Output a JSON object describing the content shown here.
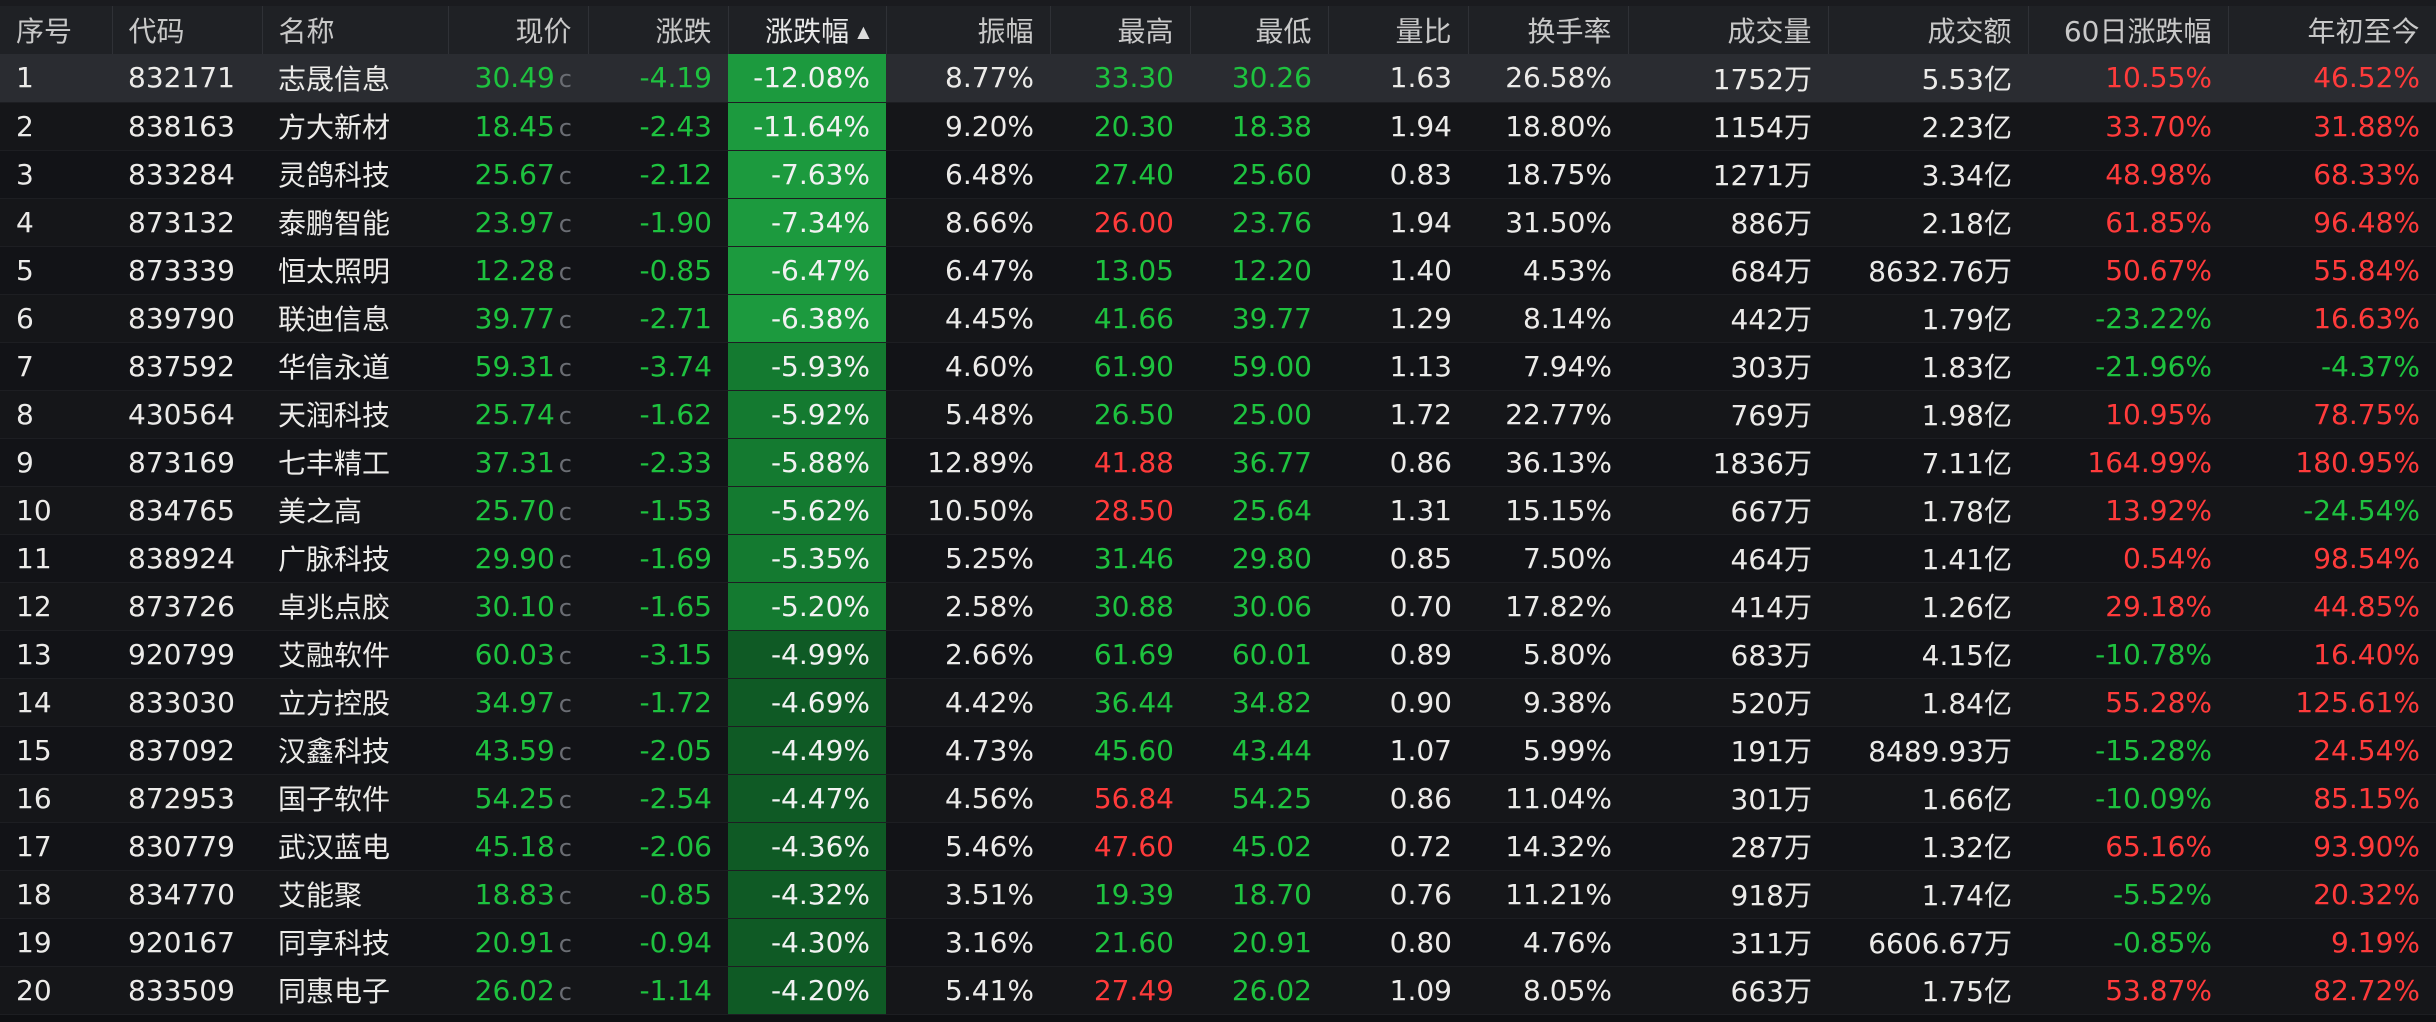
{
  "colors": {
    "up": "#ff3b3b",
    "down": "#1ec23f",
    "neutral": "#ecebe9",
    "heat_strong": "#1c9a3e",
    "heat_mid": "#147a30",
    "heat_light": "#0f5a25"
  },
  "table": {
    "sorted_column": "涨跌幅",
    "sort_direction": "ascending",
    "columns": [
      "序号",
      "代码",
      "名称",
      "现价",
      "涨跌",
      "涨跌幅",
      "振幅",
      "最高",
      "最低",
      "量比",
      "换手率",
      "成交量",
      "成交额",
      "60日涨跌幅",
      "年初至今"
    ],
    "price_suffix": "c",
    "rows": [
      {
        "idx": "1",
        "code": "832171",
        "name": "志晟信息",
        "price": "30.49",
        "chg": "-4.19",
        "pct": "-12.08%",
        "amp": "8.77%",
        "high": "33.30",
        "high_dir": "down",
        "low": "30.26",
        "ratio": "1.63",
        "turn": "26.58%",
        "vol": "1752万",
        "amount": "5.53亿",
        "d60": "10.55%",
        "d60_dir": "up",
        "ytd": "46.52%",
        "ytd_dir": "up",
        "heat": "strong"
      },
      {
        "idx": "2",
        "code": "838163",
        "name": "方大新材",
        "price": "18.45",
        "chg": "-2.43",
        "pct": "-11.64%",
        "amp": "9.20%",
        "high": "20.30",
        "high_dir": "down",
        "low": "18.38",
        "ratio": "1.94",
        "turn": "18.80%",
        "vol": "1154万",
        "amount": "2.23亿",
        "d60": "33.70%",
        "d60_dir": "up",
        "ytd": "31.88%",
        "ytd_dir": "up",
        "heat": "strong"
      },
      {
        "idx": "3",
        "code": "833284",
        "name": "灵鸽科技",
        "price": "25.67",
        "chg": "-2.12",
        "pct": "-7.63%",
        "amp": "6.48%",
        "high": "27.40",
        "high_dir": "down",
        "low": "25.60",
        "ratio": "0.83",
        "turn": "18.75%",
        "vol": "1271万",
        "amount": "3.34亿",
        "d60": "48.98%",
        "d60_dir": "up",
        "ytd": "68.33%",
        "ytd_dir": "up",
        "heat": "strong"
      },
      {
        "idx": "4",
        "code": "873132",
        "name": "泰鹏智能",
        "price": "23.97",
        "chg": "-1.90",
        "pct": "-7.34%",
        "amp": "8.66%",
        "high": "26.00",
        "high_dir": "up",
        "low": "23.76",
        "ratio": "1.94",
        "turn": "31.50%",
        "vol": "886万",
        "amount": "2.18亿",
        "d60": "61.85%",
        "d60_dir": "up",
        "ytd": "96.48%",
        "ytd_dir": "up",
        "heat": "strong"
      },
      {
        "idx": "5",
        "code": "873339",
        "name": "恒太照明",
        "price": "12.28",
        "chg": "-0.85",
        "pct": "-6.47%",
        "amp": "6.47%",
        "high": "13.05",
        "high_dir": "down",
        "low": "12.20",
        "ratio": "1.40",
        "turn": "4.53%",
        "vol": "684万",
        "amount": "8632.76万",
        "d60": "50.67%",
        "d60_dir": "up",
        "ytd": "55.84%",
        "ytd_dir": "up",
        "heat": "strong"
      },
      {
        "idx": "6",
        "code": "839790",
        "name": "联迪信息",
        "price": "39.77",
        "chg": "-2.71",
        "pct": "-6.38%",
        "amp": "4.45%",
        "high": "41.66",
        "high_dir": "down",
        "low": "39.77",
        "ratio": "1.29",
        "turn": "8.14%",
        "vol": "442万",
        "amount": "1.79亿",
        "d60": "-23.22%",
        "d60_dir": "down",
        "ytd": "16.63%",
        "ytd_dir": "up",
        "heat": "strong"
      },
      {
        "idx": "7",
        "code": "837592",
        "name": "华信永道",
        "price": "59.31",
        "chg": "-3.74",
        "pct": "-5.93%",
        "amp": "4.60%",
        "high": "61.90",
        "high_dir": "down",
        "low": "59.00",
        "ratio": "1.13",
        "turn": "7.94%",
        "vol": "303万",
        "amount": "1.83亿",
        "d60": "-21.96%",
        "d60_dir": "down",
        "ytd": "-4.37%",
        "ytd_dir": "down",
        "heat": "mid"
      },
      {
        "idx": "8",
        "code": "430564",
        "name": "天润科技",
        "price": "25.74",
        "chg": "-1.62",
        "pct": "-5.92%",
        "amp": "5.48%",
        "high": "26.50",
        "high_dir": "down",
        "low": "25.00",
        "ratio": "1.72",
        "turn": "22.77%",
        "vol": "769万",
        "amount": "1.98亿",
        "d60": "10.95%",
        "d60_dir": "up",
        "ytd": "78.75%",
        "ytd_dir": "up",
        "heat": "mid"
      },
      {
        "idx": "9",
        "code": "873169",
        "name": "七丰精工",
        "price": "37.31",
        "chg": "-2.33",
        "pct": "-5.88%",
        "amp": "12.89%",
        "high": "41.88",
        "high_dir": "up",
        "low": "36.77",
        "ratio": "0.86",
        "turn": "36.13%",
        "vol": "1836万",
        "amount": "7.11亿",
        "d60": "164.99%",
        "d60_dir": "up",
        "ytd": "180.95%",
        "ytd_dir": "up",
        "heat": "mid"
      },
      {
        "idx": "10",
        "code": "834765",
        "name": "美之高",
        "price": "25.70",
        "chg": "-1.53",
        "pct": "-5.62%",
        "amp": "10.50%",
        "high": "28.50",
        "high_dir": "up",
        "low": "25.64",
        "ratio": "1.31",
        "turn": "15.15%",
        "vol": "667万",
        "amount": "1.78亿",
        "d60": "13.92%",
        "d60_dir": "up",
        "ytd": "-24.54%",
        "ytd_dir": "down",
        "heat": "mid"
      },
      {
        "idx": "11",
        "code": "838924",
        "name": "广脉科技",
        "price": "29.90",
        "chg": "-1.69",
        "pct": "-5.35%",
        "amp": "5.25%",
        "high": "31.46",
        "high_dir": "down",
        "low": "29.80",
        "ratio": "0.85",
        "turn": "7.50%",
        "vol": "464万",
        "amount": "1.41亿",
        "d60": "0.54%",
        "d60_dir": "up",
        "ytd": "98.54%",
        "ytd_dir": "up",
        "heat": "mid"
      },
      {
        "idx": "12",
        "code": "873726",
        "name": "卓兆点胶",
        "price": "30.10",
        "chg": "-1.65",
        "pct": "-5.20%",
        "amp": "2.58%",
        "high": "30.88",
        "high_dir": "down",
        "low": "30.06",
        "ratio": "0.70",
        "turn": "17.82%",
        "vol": "414万",
        "amount": "1.26亿",
        "d60": "29.18%",
        "d60_dir": "up",
        "ytd": "44.85%",
        "ytd_dir": "up",
        "heat": "mid"
      },
      {
        "idx": "13",
        "code": "920799",
        "name": "艾融软件",
        "price": "60.03",
        "chg": "-3.15",
        "pct": "-4.99%",
        "amp": "2.66%",
        "high": "61.69",
        "high_dir": "down",
        "low": "60.01",
        "ratio": "0.89",
        "turn": "5.80%",
        "vol": "683万",
        "amount": "4.15亿",
        "d60": "-10.78%",
        "d60_dir": "down",
        "ytd": "16.40%",
        "ytd_dir": "up",
        "heat": "light"
      },
      {
        "idx": "14",
        "code": "833030",
        "name": "立方控股",
        "price": "34.97",
        "chg": "-1.72",
        "pct": "-4.69%",
        "amp": "4.42%",
        "high": "36.44",
        "high_dir": "down",
        "low": "34.82",
        "ratio": "0.90",
        "turn": "9.38%",
        "vol": "520万",
        "amount": "1.84亿",
        "d60": "55.28%",
        "d60_dir": "up",
        "ytd": "125.61%",
        "ytd_dir": "up",
        "heat": "light"
      },
      {
        "idx": "15",
        "code": "837092",
        "name": "汉鑫科技",
        "price": "43.59",
        "chg": "-2.05",
        "pct": "-4.49%",
        "amp": "4.73%",
        "high": "45.60",
        "high_dir": "down",
        "low": "43.44",
        "ratio": "1.07",
        "turn": "5.99%",
        "vol": "191万",
        "amount": "8489.93万",
        "d60": "-15.28%",
        "d60_dir": "down",
        "ytd": "24.54%",
        "ytd_dir": "up",
        "heat": "light"
      },
      {
        "idx": "16",
        "code": "872953",
        "name": "国子软件",
        "price": "54.25",
        "chg": "-2.54",
        "pct": "-4.47%",
        "amp": "4.56%",
        "high": "56.84",
        "high_dir": "up",
        "low": "54.25",
        "ratio": "0.86",
        "turn": "11.04%",
        "vol": "301万",
        "amount": "1.66亿",
        "d60": "-10.09%",
        "d60_dir": "down",
        "ytd": "85.15%",
        "ytd_dir": "up",
        "heat": "light"
      },
      {
        "idx": "17",
        "code": "830779",
        "name": "武汉蓝电",
        "price": "45.18",
        "chg": "-2.06",
        "pct": "-4.36%",
        "amp": "5.46%",
        "high": "47.60",
        "high_dir": "up",
        "low": "45.02",
        "ratio": "0.72",
        "turn": "14.32%",
        "vol": "287万",
        "amount": "1.32亿",
        "d60": "65.16%",
        "d60_dir": "up",
        "ytd": "93.90%",
        "ytd_dir": "up",
        "heat": "light"
      },
      {
        "idx": "18",
        "code": "834770",
        "name": "艾能聚",
        "price": "18.83",
        "chg": "-0.85",
        "pct": "-4.32%",
        "amp": "3.51%",
        "high": "19.39",
        "high_dir": "down",
        "low": "18.70",
        "ratio": "0.76",
        "turn": "11.21%",
        "vol": "918万",
        "amount": "1.74亿",
        "d60": "-5.52%",
        "d60_dir": "down",
        "ytd": "20.32%",
        "ytd_dir": "up",
        "heat": "light"
      },
      {
        "idx": "19",
        "code": "920167",
        "name": "同享科技",
        "price": "20.91",
        "chg": "-0.94",
        "pct": "-4.30%",
        "amp": "3.16%",
        "high": "21.60",
        "high_dir": "down",
        "low": "20.91",
        "ratio": "0.80",
        "turn": "4.76%",
        "vol": "311万",
        "amount": "6606.67万",
        "d60": "-0.85%",
        "d60_dir": "down",
        "ytd": "9.19%",
        "ytd_dir": "up",
        "heat": "light"
      },
      {
        "idx": "20",
        "code": "833509",
        "name": "同惠电子",
        "price": "26.02",
        "chg": "-1.14",
        "pct": "-4.20%",
        "amp": "5.41%",
        "high": "27.49",
        "high_dir": "up",
        "low": "26.02",
        "ratio": "1.09",
        "turn": "8.05%",
        "vol": "663万",
        "amount": "1.75亿",
        "d60": "53.87%",
        "d60_dir": "up",
        "ytd": "82.72%",
        "ytd_dir": "up",
        "heat": "light"
      }
    ]
  }
}
